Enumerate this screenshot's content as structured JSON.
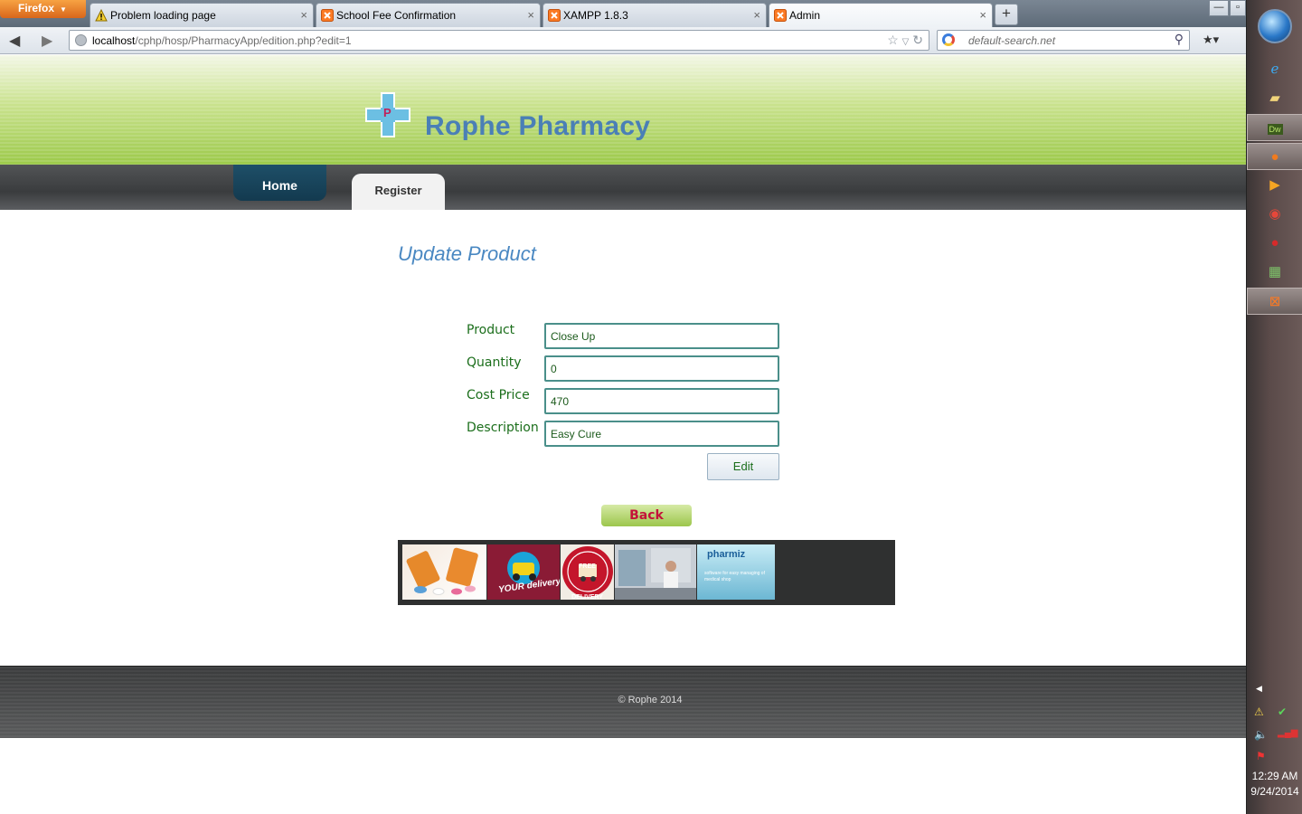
{
  "browser": {
    "menu_button": "Firefox",
    "tabs": [
      {
        "label": "Problem loading page"
      },
      {
        "label": "School Fee Confirmation"
      },
      {
        "label": "XAMPP 1.8.3"
      },
      {
        "label": "Admin"
      }
    ],
    "url_host": "localhost",
    "url_path": "/cphp/hosp/PharmacyApp/edition.php?edit=1",
    "search_placeholder": "default-search.net"
  },
  "site": {
    "logo_letter": "P",
    "title": "Rophe Pharmacy"
  },
  "menu": {
    "home": "Home",
    "register": "Register"
  },
  "main": {
    "title": "Update Product",
    "form": {
      "product_label": "Product",
      "product_value": "Close Up",
      "quantity_label": "Quantity",
      "quantity_value": "0",
      "cost_label": "Cost Price",
      "cost_value": "470",
      "description_label": "Description",
      "description_value": "Easy Cure",
      "edit_button": "Edit"
    },
    "back_button": "Back",
    "banner": {
      "delivery_text": "YOUR delivery!",
      "free_delivery_text": "FREE DELIVERY",
      "pharmiz_name": "pharmiz",
      "pharmiz_tagline": "software for easy managing of medical shop"
    }
  },
  "footer": {
    "copyright": "© Rophe 2014"
  },
  "taskbar": {
    "time": "12:29 AM",
    "date": "9/24/2014",
    "pinned_dw": "Dw"
  }
}
